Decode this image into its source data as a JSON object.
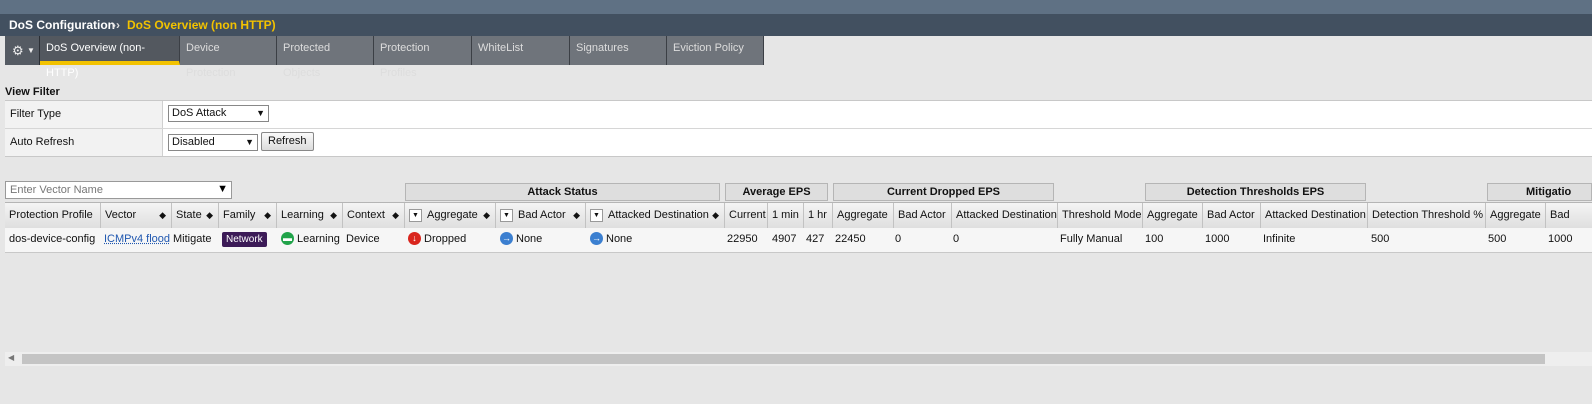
{
  "title": {
    "section": "DoS Configuration",
    "separator": "››",
    "page": "DoS Overview (non HTTP)"
  },
  "tabs": [
    {
      "label": "DoS Overview (non-HTTP)"
    },
    {
      "label": "Device Protection"
    },
    {
      "label": "Protected Objects"
    },
    {
      "label": "Protection Profiles"
    },
    {
      "label": "WhiteList"
    },
    {
      "label": "Signatures"
    },
    {
      "label": "Eviction Policy"
    }
  ],
  "view_filter": {
    "title": "View Filter",
    "filter_type": {
      "label": "Filter Type",
      "value": "DoS Attack"
    },
    "auto_refresh": {
      "label": "Auto Refresh",
      "value": "Disabled",
      "button": "Refresh"
    }
  },
  "search": {
    "placeholder": "Enter Vector Name"
  },
  "groups": {
    "attack_status": "Attack Status",
    "average_eps": "Average EPS",
    "current_dropped_eps": "Current Dropped EPS",
    "detection_thresholds_eps": "Detection Thresholds EPS",
    "mitigation": "Mitigatio"
  },
  "columns": {
    "protection_profile": "Protection Profile",
    "vector": "Vector",
    "state": "State",
    "family": "Family",
    "learning": "Learning",
    "context": "Context",
    "agg": "Aggregate",
    "bad_actor": "Bad Actor",
    "attacked_dest": "Attacked Destination",
    "current": "Current",
    "one_min": "1 min",
    "one_hr": "1 hr",
    "drop_agg": "Aggregate",
    "drop_bad_actor": "Bad Actor",
    "drop_attacked_dest": "Attacked Destination",
    "threshold_mode": "Threshold Mode",
    "det_agg": "Aggregate",
    "det_bad_actor": "Bad Actor",
    "det_attacked_dest": "Attacked Destination",
    "det_threshold_pct": "Detection Threshold %",
    "mit_agg": "Aggregate",
    "mit_bad": "Bad"
  },
  "row": {
    "protection_profile": "dos-device-config",
    "vector": "ICMPv4 flood",
    "state": "Mitigate",
    "family": "Network",
    "learning": "Learning",
    "context": "Device",
    "agg": "Dropped",
    "bad_actor": "None",
    "attacked_dest": "None",
    "current": "22950",
    "one_min": "4907",
    "one_hr": "427",
    "drop_agg": "22450",
    "drop_bad_actor": "0",
    "drop_attacked_dest": "0",
    "threshold_mode": "Fully Manual",
    "det_agg": "100",
    "det_bad_actor": "1000",
    "det_attacked_dest": "Infinite",
    "det_threshold_pct": "500",
    "mit_agg": "500",
    "mit_bad": "1000"
  },
  "colors": {
    "title_bar": "#425060",
    "accent": "#f2c200",
    "family_badge": "#3c1b57",
    "dropped_icon": "#d9251d",
    "none_icon": "#3b7fd0",
    "learning_icon": "#21a34a"
  },
  "icons": [
    "gear-icon",
    "chevron-down-icon",
    "filter-icon",
    "sort-icon",
    "arrow-down-icon",
    "arrow-right-icon",
    "learning-icon"
  ]
}
